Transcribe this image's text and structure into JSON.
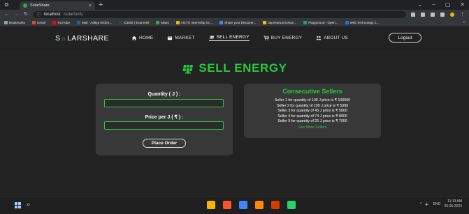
{
  "browser": {
    "tab_title": "SolarShare",
    "url_host": "localhost",
    "url_path": "/solarfunfu",
    "bookmarks": [
      {
        "label": "Bookmarks",
        "color": "#9aa0a6"
      },
      {
        "label": "Gmail",
        "color": "#ea4335"
      },
      {
        "label": "YouTube",
        "color": "#ff0000"
      },
      {
        "label": "Mail - Aditya Kishor...",
        "color": "#0a66c2"
      },
      {
        "label": "ICBSE | Examvelt",
        "color": "#3c4043"
      },
      {
        "label": "Maps",
        "color": "#34a853"
      },
      {
        "label": "AICTE Internship Sc...",
        "color": "#f4b400"
      },
      {
        "label": "Share your Discover...",
        "color": "#4285f4"
      },
      {
        "label": "aspireartunmohan...",
        "color": "#fbbc04"
      },
      {
        "label": "Playground - Open...",
        "color": "#10a37f"
      },
      {
        "label": "Web Technology 1...",
        "color": "#1a73e8"
      }
    ]
  },
  "site": {
    "brand_start": "S",
    "brand_end": "LARSHARE",
    "nav": [
      {
        "label": "HOME",
        "icon": "home-icon"
      },
      {
        "label": "MARKET",
        "icon": "market-icon"
      },
      {
        "label": "SELL ENERGY",
        "icon": "solar-panel-icon"
      },
      {
        "label": "BUY ENERGY",
        "icon": "cart-icon"
      },
      {
        "label": "ABOUT US",
        "icon": "team-icon"
      }
    ],
    "logout_label": "Logout"
  },
  "page": {
    "title": "SELL ENERGY",
    "form": {
      "quantity_label": "Quantity ( J ) :",
      "quantity_value": "",
      "price_label": "Price per J ( ₹ ) :",
      "price_value": "",
      "submit_label": "Place Order"
    },
    "sellers": {
      "title": "Consecutive Sellers",
      "lines": [
        "Seller 1 for quantity of 100 J price is ₹ 100000",
        "Seller 2 for quantity of 100 J price is ₹ 5000",
        "Seller 3 for quantity of 45 J price is ₹ 5800",
        "Seller 4 for quantity of 74 J price is ₹ 8000",
        "Seller 5 for quantity of 25 J price is ₹ 7000"
      ],
      "see_more": "See More Sellers"
    }
  },
  "taskbar": {
    "apps": [
      {
        "name": "file-explorer-icon",
        "color": "#f4b400"
      },
      {
        "name": "brave-browser-icon",
        "color": "#fb542b"
      },
      {
        "name": "chrome-icon",
        "color": "#4285f4"
      },
      {
        "name": "vlc-icon",
        "color": "#ff8800"
      },
      {
        "name": "office-icon",
        "color": "#d83b01"
      },
      {
        "name": "whatsapp-icon",
        "color": "#25d366"
      }
    ],
    "language": "ENG",
    "time": "11:13 AM",
    "date": "26-05-2023"
  },
  "colors": {
    "accent": "#27c93f",
    "page_bg": "#232323",
    "card_bg": "#383838",
    "navbar_bg": "#222222"
  }
}
